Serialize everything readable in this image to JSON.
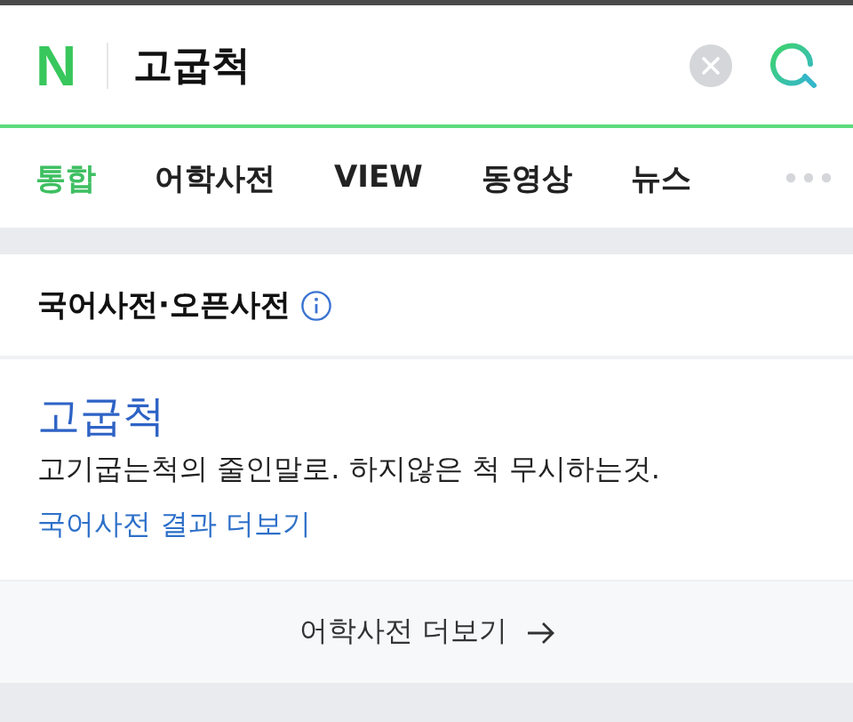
{
  "search": {
    "logo": "N",
    "value": "고굽척"
  },
  "tabs": [
    {
      "label": "통합",
      "selected": true
    },
    {
      "label": "어학사전",
      "selected": false
    },
    {
      "label": "VIEW",
      "selected": false
    },
    {
      "label": "동영상",
      "selected": false
    },
    {
      "label": "뉴스",
      "selected": false
    }
  ],
  "card": {
    "title": "국어사전·오픈사전",
    "entry": {
      "word": "고굽척",
      "definition": "고기굽는척의 줄인말로. 하지않은 척 무시하는것.",
      "more_link": "국어사전 결과 더보기"
    },
    "footer_link": "어학사전 더보기"
  }
}
